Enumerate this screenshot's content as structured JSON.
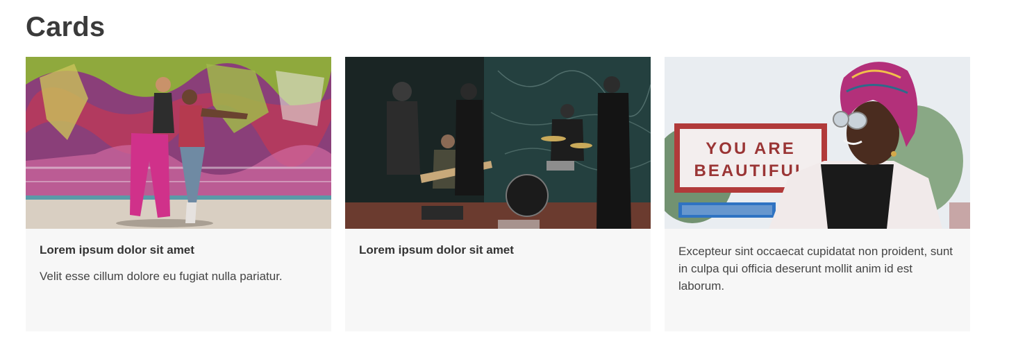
{
  "page": {
    "title": "Cards"
  },
  "cards": [
    {
      "image_label": "graffiti-dancers-photo",
      "title": "Lorem ipsum dolor sit amet",
      "text": "Velit esse cillum dolore eu fugiat nulla pariatur."
    },
    {
      "image_label": "street-band-photo",
      "title": "Lorem ipsum dolor sit amet",
      "text": ""
    },
    {
      "image_label": "you-are-beautiful-photo",
      "title": "",
      "text": "Excepteur sint occaecat cupidatat non proident, sunt in culpa qui officia deserunt mollit anim id est laborum.",
      "sign_line1": "YOU ARE",
      "sign_line2": "BEAUTIFUL"
    }
  ]
}
